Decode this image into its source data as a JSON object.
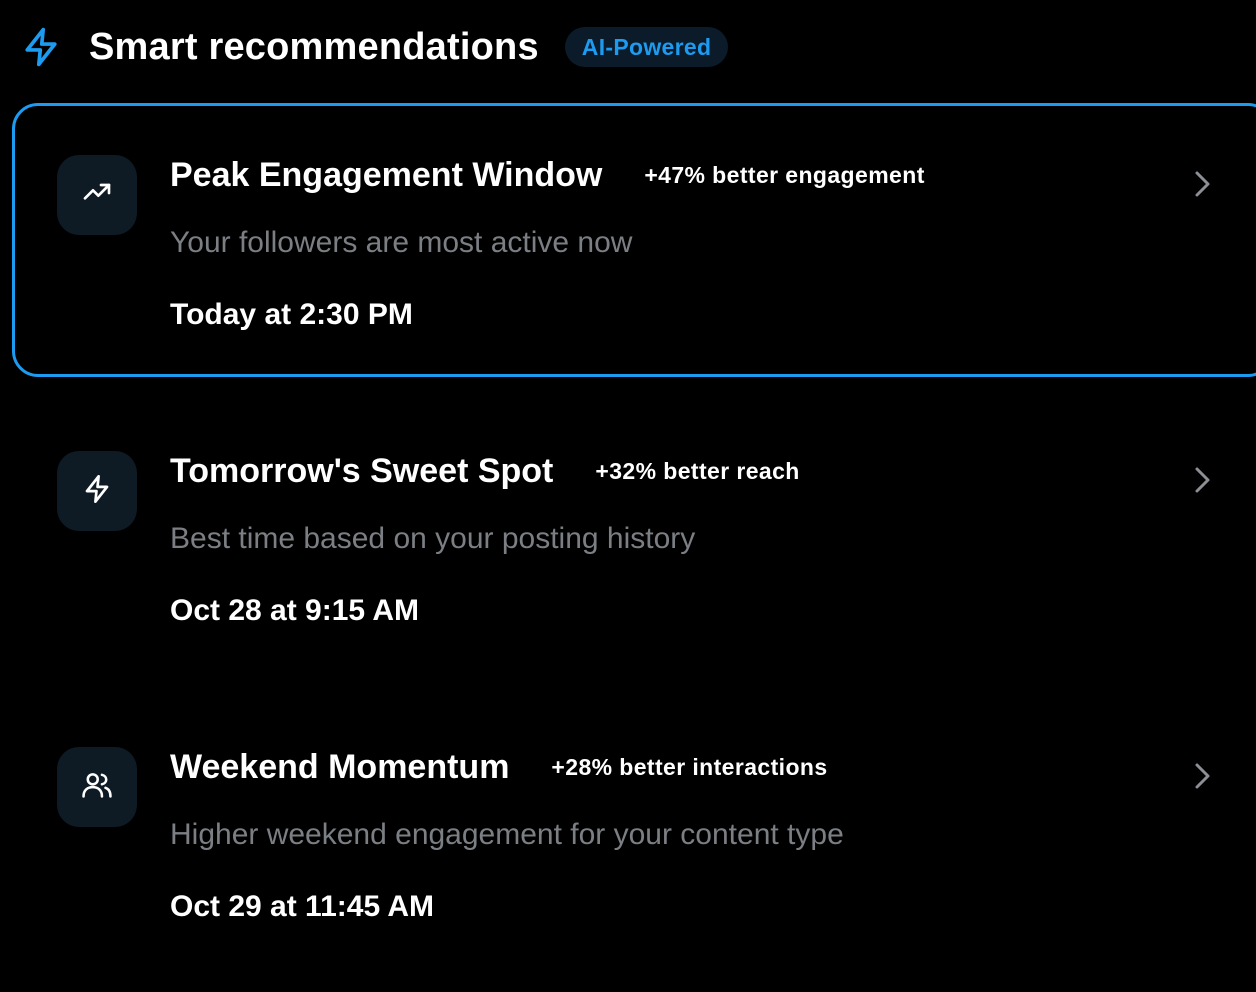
{
  "header": {
    "icon": "bolt-icon",
    "title": "Smart recommendations",
    "badge": "AI-Powered"
  },
  "colors": {
    "accent": "#1d9bf0",
    "background": "#000000",
    "muted_text": "#7b7f84",
    "icon_tile": "#0e1a24"
  },
  "recommendations": [
    {
      "icon": "trending-up-icon",
      "title": "Peak Engagement Window",
      "stat": "+47% better engagement",
      "description": "Your followers are most active now",
      "time": "Today at 2:30 PM",
      "selected": true
    },
    {
      "icon": "bolt-icon",
      "title": "Tomorrow's Sweet Spot",
      "stat": "+32% better reach",
      "description": "Best time based on your posting history",
      "time": "Oct 28 at 9:15 AM",
      "selected": false
    },
    {
      "icon": "users-icon",
      "title": "Weekend Momentum",
      "stat": "+28% better interactions",
      "description": "Higher weekend engagement for your content type",
      "time": "Oct 29 at 11:45 AM",
      "selected": false
    }
  ]
}
